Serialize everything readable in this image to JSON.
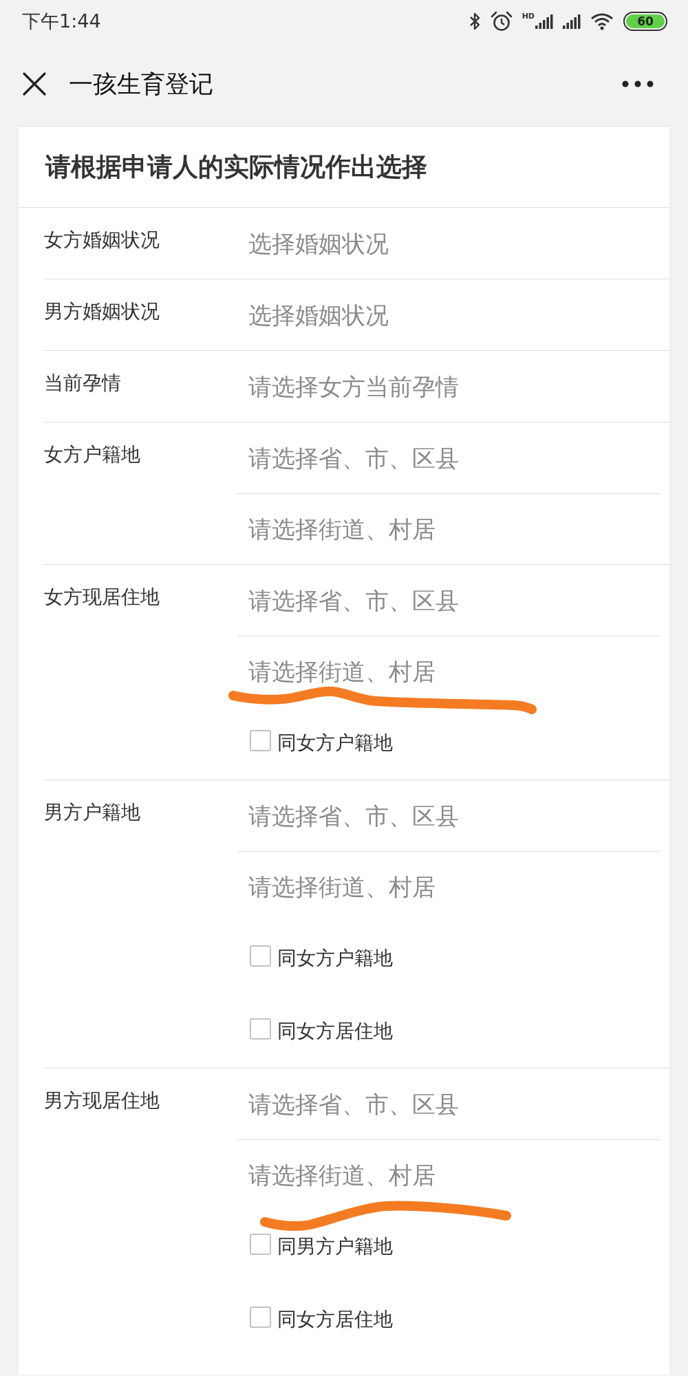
{
  "status_bar": {
    "time": "下午1:44",
    "network_label": "HD",
    "battery": "60"
  },
  "header": {
    "title": "一孩生育登记"
  },
  "form": {
    "title": "请根据申请人的实际情况作出选择",
    "rows": [
      {
        "label": "女方婚姻状况",
        "fields": [
          {
            "kind": "select",
            "placeholder": "选择婚姻状况",
            "marked": false
          }
        ]
      },
      {
        "label": "男方婚姻状况",
        "fields": [
          {
            "kind": "select",
            "placeholder": "选择婚姻状况",
            "marked": false
          }
        ]
      },
      {
        "label": "当前孕情",
        "fields": [
          {
            "kind": "select",
            "placeholder": "请选择女方当前孕情",
            "marked": false
          }
        ]
      },
      {
        "label": "女方户籍地",
        "fields": [
          {
            "kind": "select",
            "placeholder": "请选择省、市、区县",
            "marked": false
          },
          {
            "kind": "select",
            "placeholder": "请选择街道、村居",
            "marked": false
          }
        ]
      },
      {
        "label": "女方现居住地",
        "fields": [
          {
            "kind": "select",
            "placeholder": "请选择省、市、区县",
            "marked": false
          },
          {
            "kind": "select",
            "placeholder": "请选择街道、村居",
            "marked": true
          },
          {
            "kind": "checkbox",
            "label": "同女方户籍地",
            "checked": false
          }
        ]
      },
      {
        "label": "男方户籍地",
        "fields": [
          {
            "kind": "select",
            "placeholder": "请选择省、市、区县",
            "marked": false
          },
          {
            "kind": "select",
            "placeholder": "请选择街道、村居",
            "marked": false
          },
          {
            "kind": "checkbox",
            "label": "同女方户籍地",
            "checked": false
          },
          {
            "kind": "checkbox",
            "label": "同女方居住地",
            "checked": false
          }
        ]
      },
      {
        "label": "男方现居住地",
        "fields": [
          {
            "kind": "select",
            "placeholder": "请选择省、市、区县",
            "marked": false
          },
          {
            "kind": "select",
            "placeholder": "请选择街道、村居",
            "marked": true
          },
          {
            "kind": "checkbox",
            "label": "同男方户籍地",
            "checked": false
          },
          {
            "kind": "checkbox",
            "label": "同女方居住地",
            "checked": false
          }
        ]
      }
    ]
  }
}
